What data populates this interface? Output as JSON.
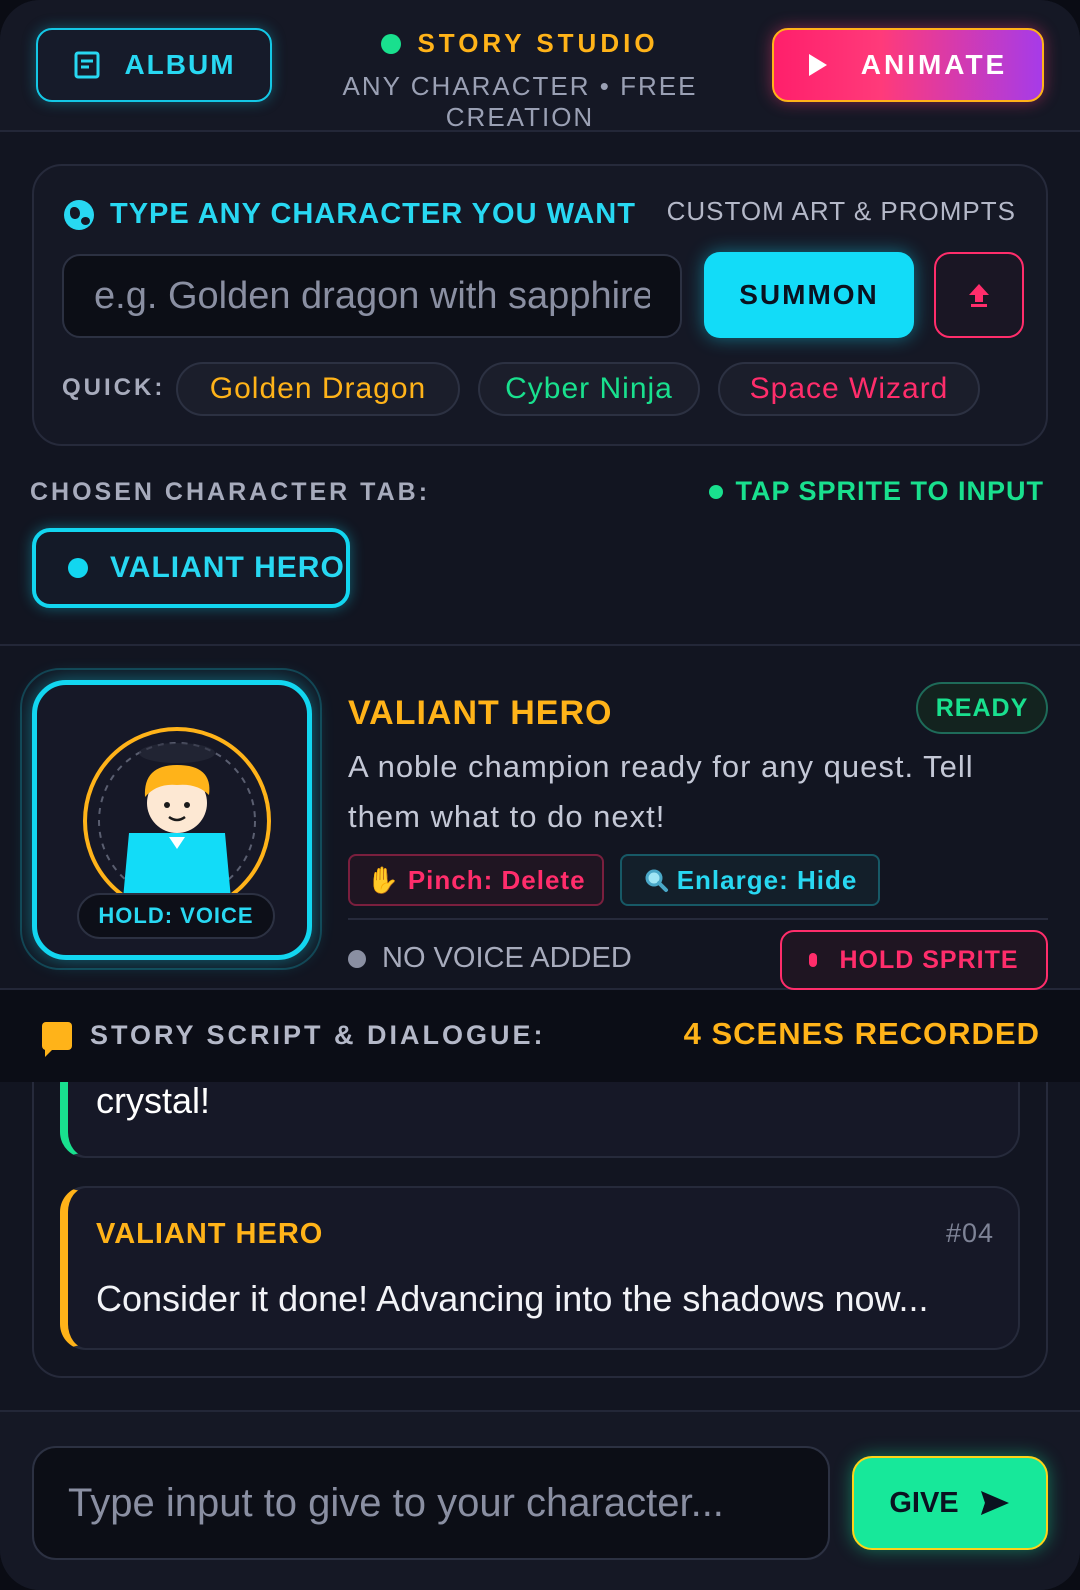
{
  "header": {
    "album_label": "ALBUM",
    "brand_title": "STORY STUDIO",
    "brand_subtitle": "ANY CHARACTER • FREE CREATION",
    "animate_label": "ANIMATE"
  },
  "create": {
    "title": "TYPE ANY CHARACTER YOU WANT",
    "hint": "CUSTOM ART & PROMPTS",
    "input_placeholder": "e.g. Golden dragon with sapphire eyes",
    "input_value": "",
    "summon_label": "SUMMON",
    "quick_label": "QUICK:",
    "quick_chips": [
      "Golden Dragon",
      "Cyber Ninja",
      "Space Wizard"
    ]
  },
  "chosen": {
    "label": "CHOSEN CHARACTER TAB:",
    "tap_hint": "TAP SPRITE TO INPUT",
    "active_tab": "VALIANT HERO"
  },
  "character": {
    "hold_voice": "HOLD: VOICE",
    "name": "VALIANT HERO",
    "status": "READY",
    "description": "A noble champion ready for any quest. Tell them what to do next!",
    "pinch_label": "Pinch: Delete",
    "enlarge_label": "Enlarge: Hide",
    "voice_status": "NO VOICE ADDED",
    "hold_sprite_label": "HOLD SPRITE"
  },
  "script": {
    "title": "STORY SCRIPT & DIALOGUE:",
    "scene_count": "4 SCENES RECORDED",
    "messages": [
      {
        "text": "crystal!"
      },
      {
        "speaker": "VALIANT HERO",
        "number": "#04",
        "text": "Consider it done! Advancing into the shadows now..."
      }
    ]
  },
  "composer": {
    "placeholder": "Type input to give to your character...",
    "give_label": "GIVE"
  },
  "colors": {
    "cyan": "#12d6f0",
    "gold": "#ffb319",
    "green": "#19e08e",
    "pink": "#ff2d6b",
    "background": "#121521"
  }
}
